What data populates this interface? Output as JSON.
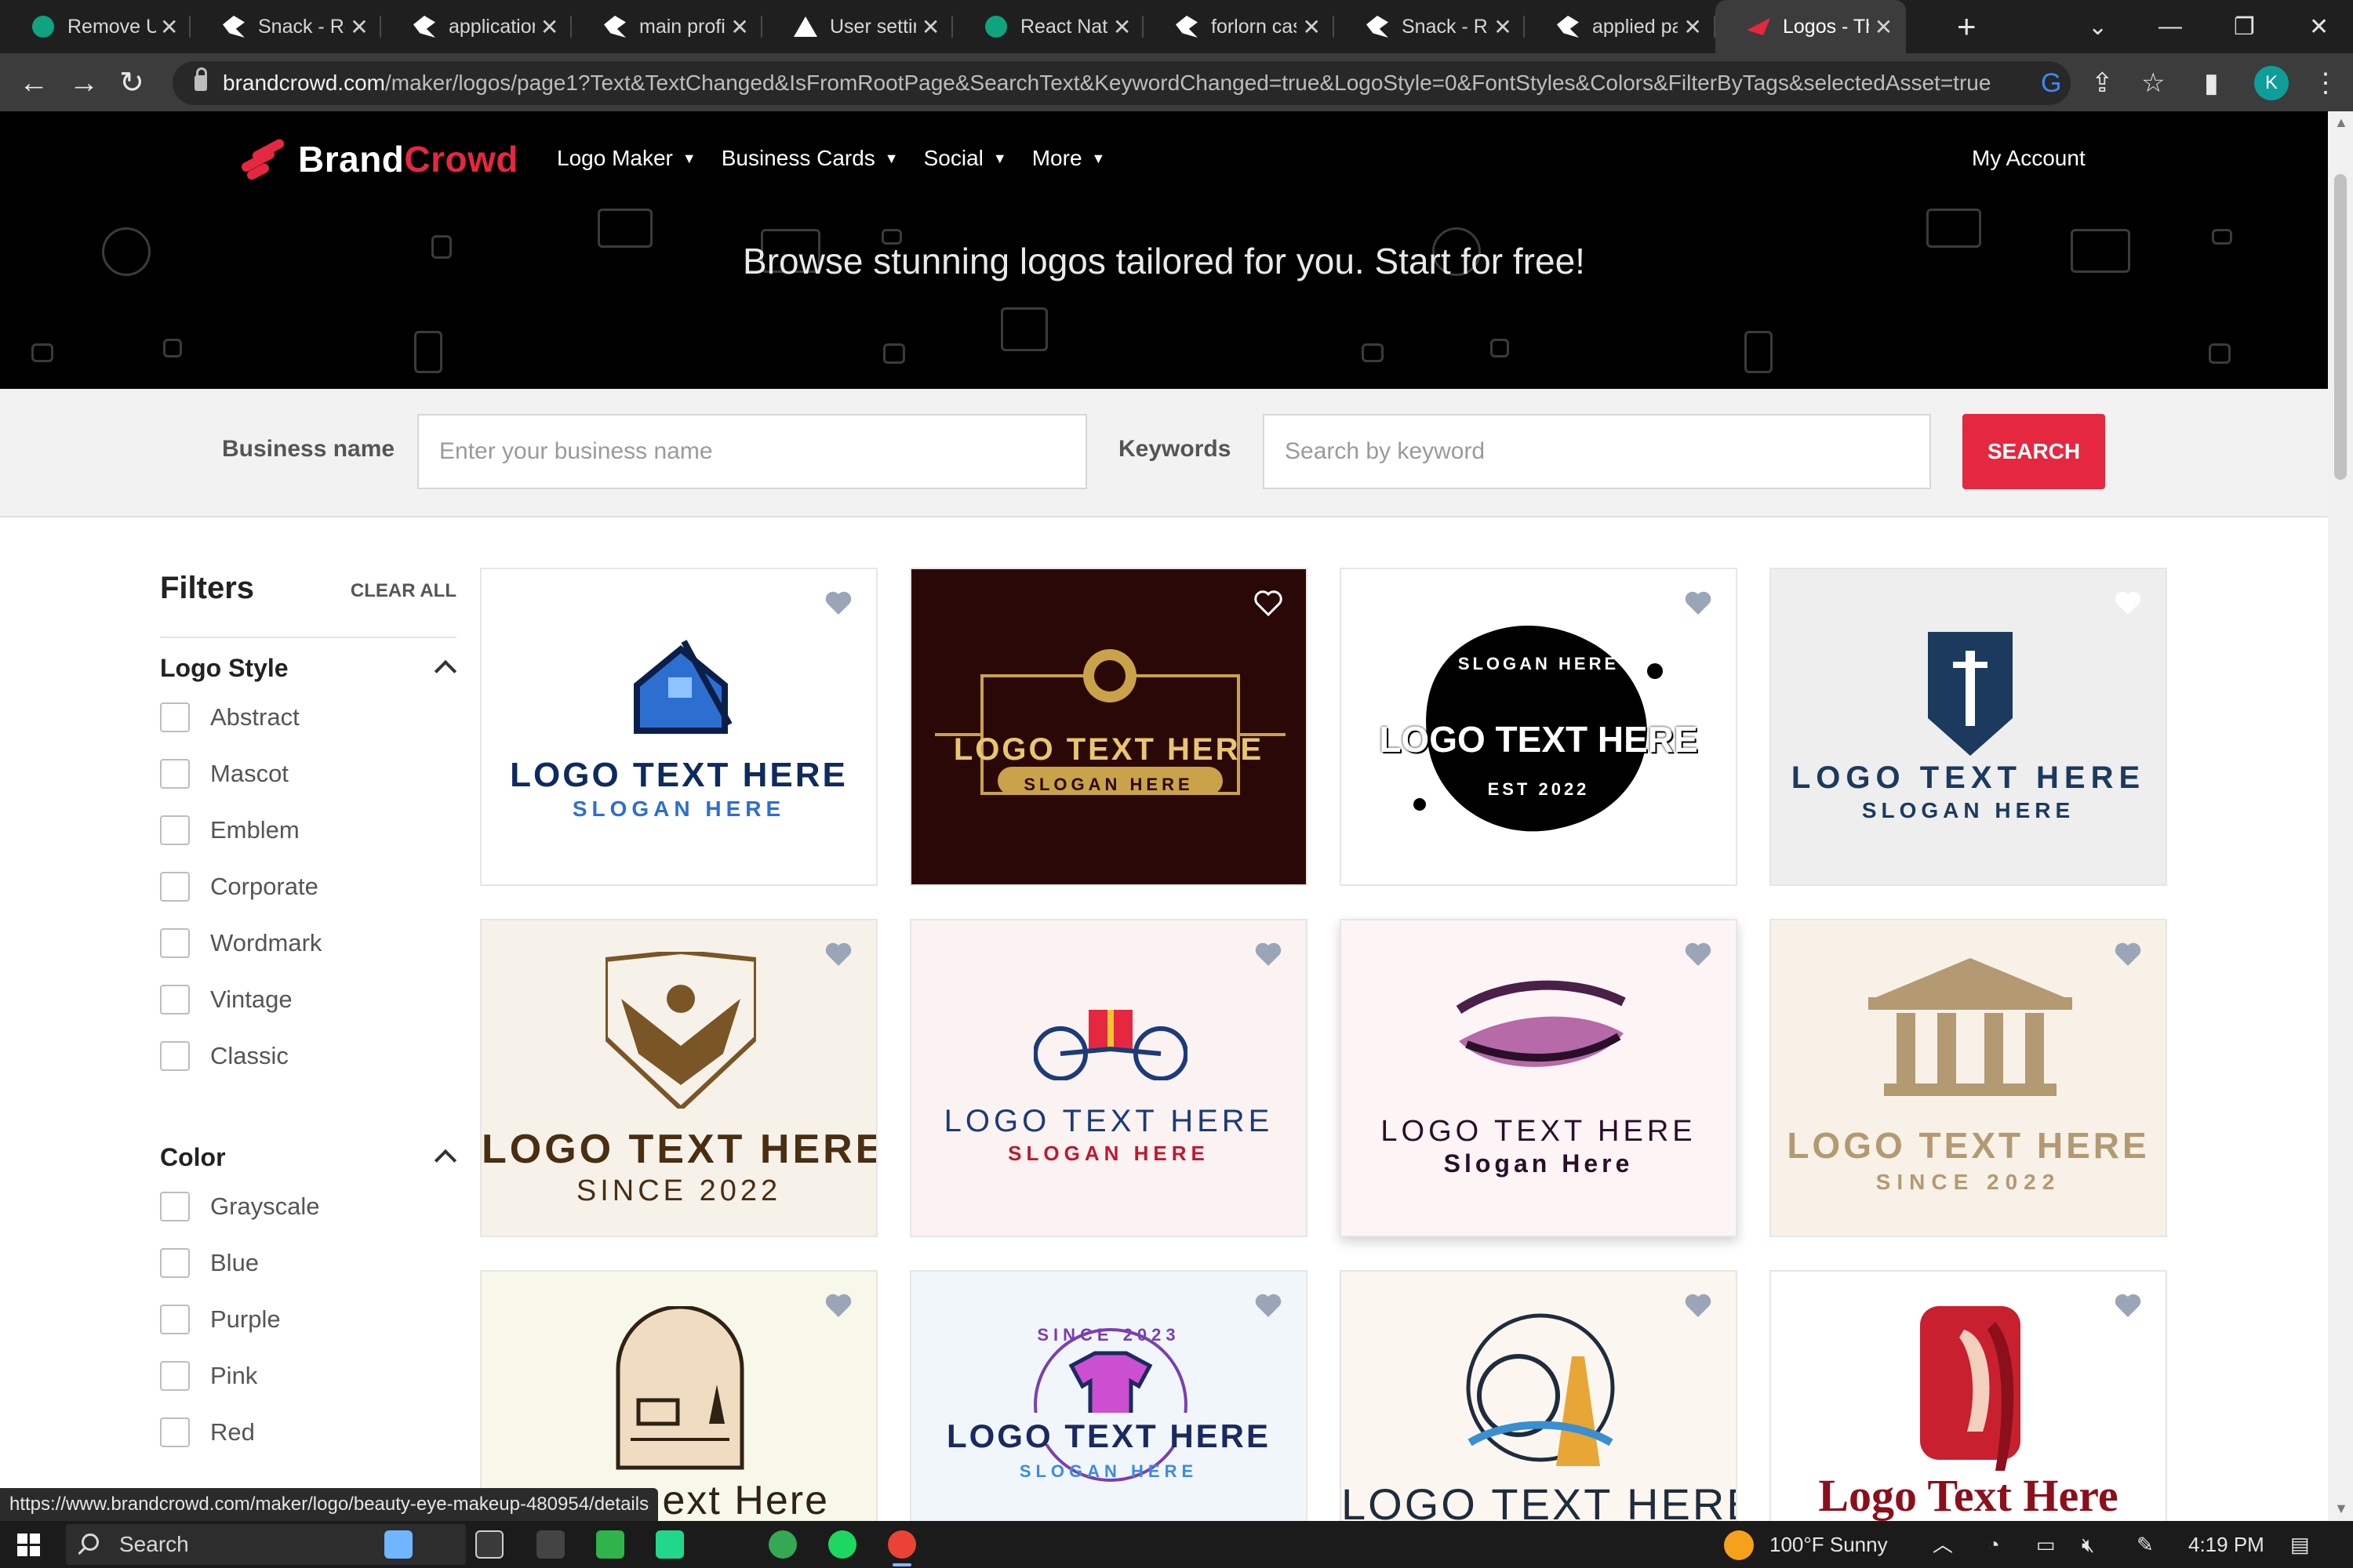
{
  "browser": {
    "tabs": [
      {
        "title": "Remove Us",
        "icon": "chatgpt-icon"
      },
      {
        "title": "Snack - Re",
        "icon": "snack-icon"
      },
      {
        "title": "application",
        "icon": "snack-icon"
      },
      {
        "title": "main profil",
        "icon": "snack-icon"
      },
      {
        "title": "User settin",
        "icon": "vercel-icon"
      },
      {
        "title": "React Nativ",
        "icon": "chatgpt-icon"
      },
      {
        "title": "forlorn cas",
        "icon": "snack-icon"
      },
      {
        "title": "Snack - Re",
        "icon": "snack-icon"
      },
      {
        "title": "applied pa",
        "icon": "snack-icon"
      },
      {
        "title": "Logos - Th",
        "icon": "brandcrowd-icon"
      }
    ],
    "new_tab": "+",
    "url_host": "brandcrowd.com",
    "url_path": "/maker/logos/page1?Text&TextChanged&IsFromRootPage&SearchText&KeywordChanged=true&LogoStyle=0&FontStyles&Colors&FilterByTags&selectedAsset=true",
    "profile_initial": "K"
  },
  "site": {
    "brand_part1": "Brand",
    "brand_part2": "Crowd",
    "nav": [
      "Logo Maker",
      "Business Cards",
      "Social",
      "More"
    ],
    "my_account": "My Account",
    "tagline": "Browse stunning logos tailored for you. Start for free!"
  },
  "search": {
    "business_label": "Business name",
    "business_placeholder": "Enter your business name",
    "keywords_label": "Keywords",
    "keywords_placeholder": "Search by keyword",
    "button": "SEARCH"
  },
  "filters": {
    "title": "Filters",
    "clear_all": "CLEAR ALL",
    "logo_style_title": "Logo Style",
    "logo_styles": [
      "Abstract",
      "Mascot",
      "Emblem",
      "Corporate",
      "Wordmark",
      "Vintage",
      "Classic"
    ],
    "color_title": "Color",
    "colors": [
      "Grayscale",
      "Blue",
      "Purple",
      "Pink",
      "Red"
    ]
  },
  "cards": [
    {
      "text": "LOGO TEXT HERE",
      "slogan": "SLOGAN HERE",
      "bg": "#ffffff"
    },
    {
      "text": "LOGO TEXT HERE",
      "slogan": "SLOGAN HERE",
      "bg": "#2b0808"
    },
    {
      "text": "LOGO TEXT HERE",
      "slogan": "SLOGAN HERE",
      "extra": "EST 2022",
      "bg": "#ffffff"
    },
    {
      "text": "LOGO TEXT HERE",
      "slogan": "SLOGAN HERE",
      "bg": "#eeeeee"
    },
    {
      "text": "LOGO TEXT HERE",
      "slogan": "SINCE 2022",
      "bg": "#f6f2ea"
    },
    {
      "text": "LOGO TEXT HERE",
      "slogan": "SLOGAN HERE",
      "bg": "#fbf2f2"
    },
    {
      "text": "LOGO TEXT HERE",
      "slogan": "Slogan Here",
      "bg": "#fdf5f5"
    },
    {
      "text": "LOGO TEXT HERE",
      "slogan": "SINCE 2022",
      "bg": "#f8f1e7"
    },
    {
      "text": "ext Here",
      "slogan": "",
      "bg": "#f7f7ea"
    },
    {
      "text": "LOGO TEXT HERE",
      "slogan": "SLOGAN HERE",
      "extra": "SINCE 2023",
      "bg": "#f1f6fb"
    },
    {
      "text": "LOGO TEXT HERE",
      "slogan": "",
      "bg": "#fbf7f0"
    },
    {
      "text": "Logo Text Here",
      "slogan": "",
      "bg": "#ffffff"
    }
  ],
  "status_url": "https://www.brandcrowd.com/maker/logo/beauty-eye-makeup-480954/details",
  "taskbar": {
    "search": "Search",
    "weather": "100°F  Sunny",
    "time": "4:19 PM"
  },
  "colors": {
    "brand_red": "#e5273f",
    "hero_bg": "#000000",
    "search_bg": "#f2f2f2"
  }
}
